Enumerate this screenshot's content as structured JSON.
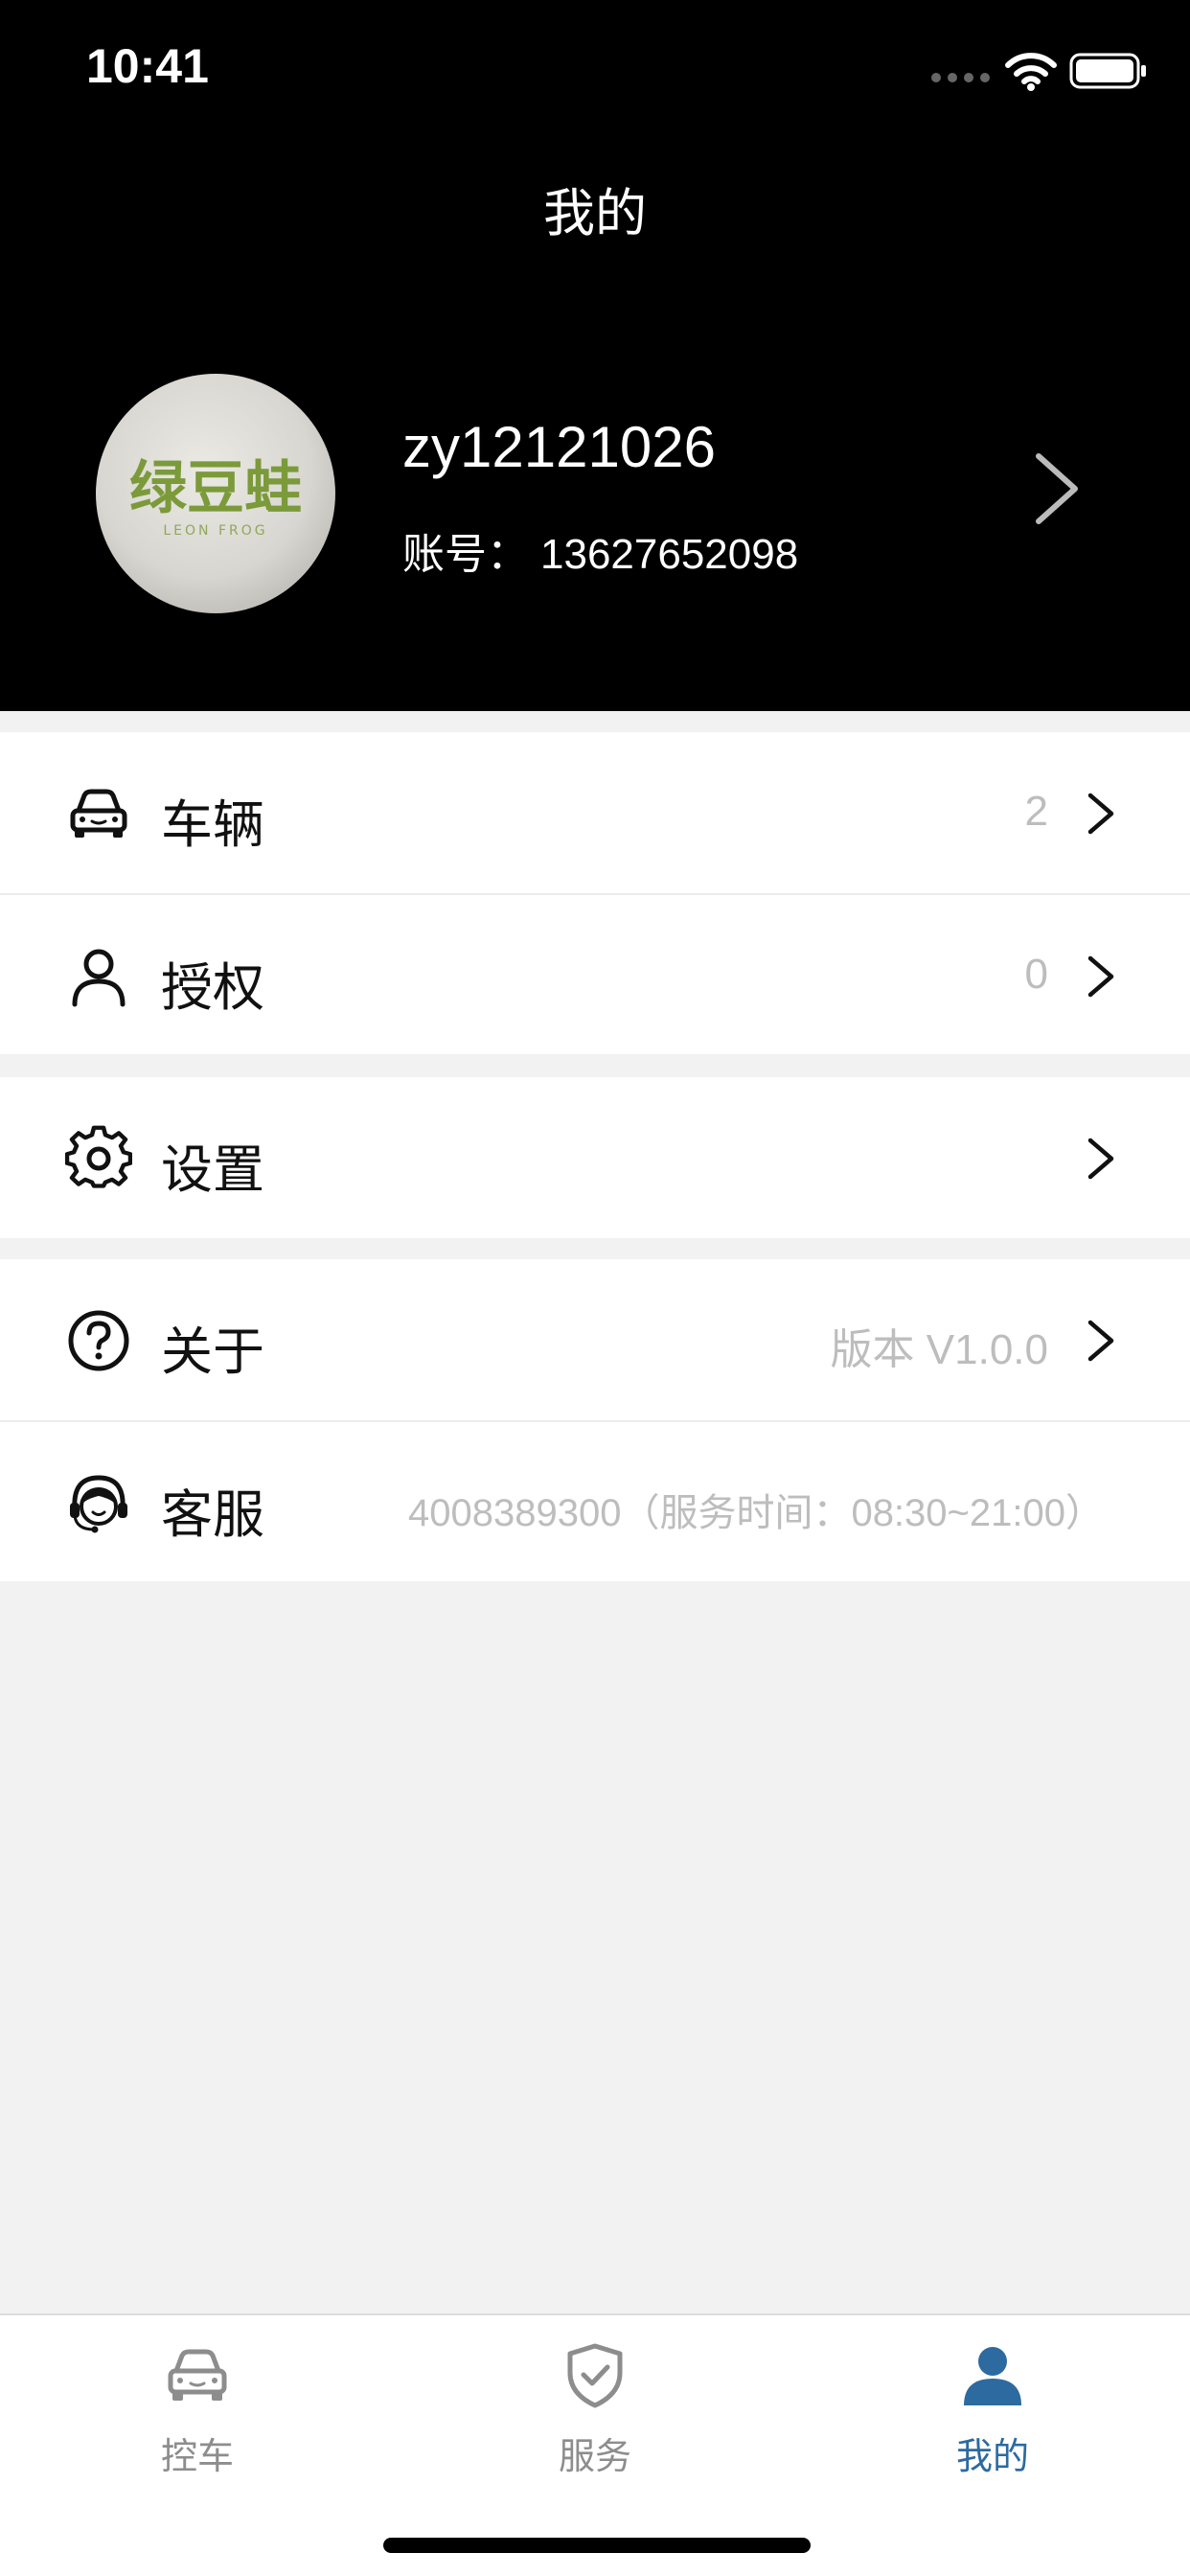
{
  "status_bar": {
    "time": "10:41",
    "icons": [
      "cellular-dots-icon",
      "wifi-icon",
      "battery-icon"
    ]
  },
  "header": {
    "title": "我的"
  },
  "profile": {
    "avatar_icon": "avatar-logo-icon",
    "avatar_text": "绿豆蛙",
    "avatar_subtext": "LEON FROG",
    "username": "zy12121026",
    "account_label": "账号：",
    "account_value": "13627652098"
  },
  "menu": {
    "group1": [
      {
        "icon": "car-icon",
        "label": "车辆",
        "value": "2"
      },
      {
        "icon": "user-icon",
        "label": "授权",
        "value": "0"
      }
    ],
    "group2": [
      {
        "icon": "gear-icon",
        "label": "设置",
        "value": ""
      }
    ],
    "group3": [
      {
        "icon": "question-circle-icon",
        "label": "关于",
        "value": "版本 V1.0.0"
      },
      {
        "icon": "headset-icon",
        "label": "客服",
        "value": "4008389300（服务时间：08:30~21:00）"
      }
    ]
  },
  "tabbar": {
    "tabs": [
      {
        "icon": "car-icon",
        "label": "控车",
        "active": false
      },
      {
        "icon": "shield-check-icon",
        "label": "服务",
        "active": false
      },
      {
        "icon": "person-icon",
        "label": "我的",
        "active": true
      }
    ]
  },
  "colors": {
    "header_bg": "#000000",
    "page_bg": "#f2f2f2",
    "active_tab": "#2d6aa0",
    "inactive_tab": "#8d8d8d",
    "muted_value": "#bdbdbd",
    "avatar_green": "#7b9a3a"
  }
}
